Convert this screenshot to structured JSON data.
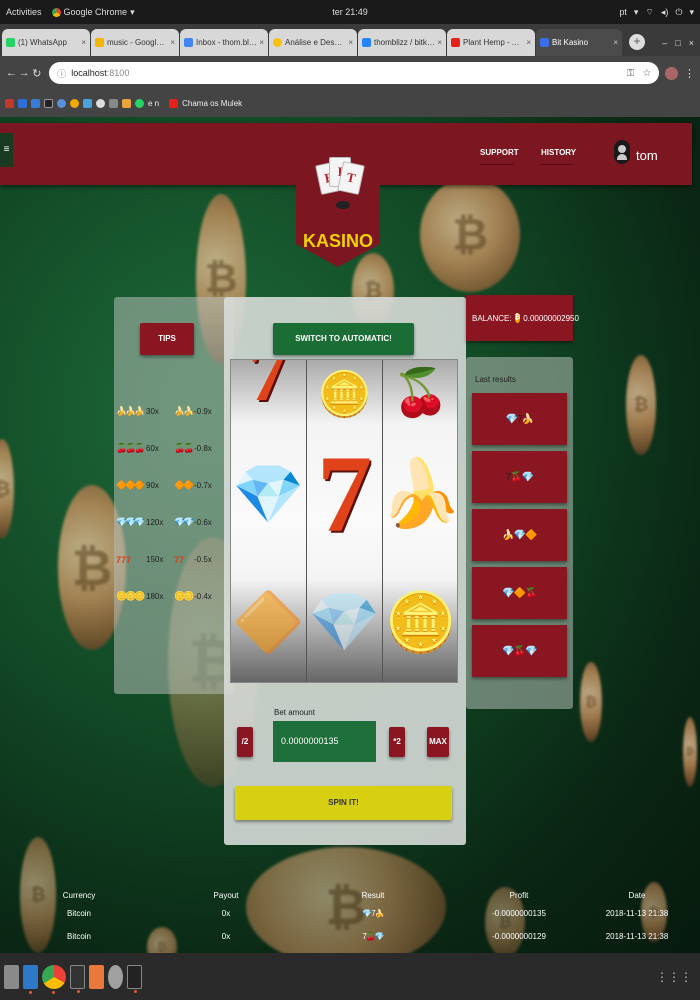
{
  "system": {
    "activities": "Activities",
    "app_name": "Google Chrome",
    "clock": "ter 21:49",
    "lang": "pt"
  },
  "tabs": [
    {
      "title": "(1) WhatsApp",
      "color": "#25d366"
    },
    {
      "title": "music - Google Drive",
      "color": "#f4b400"
    },
    {
      "title": "Inbox - thom.blizz@gmail",
      "color": "#4285f4"
    },
    {
      "title": "Análise e Desenvolvimen",
      "color": "#f4c20d"
    },
    {
      "title": "thomblizz / bitkasino",
      "color": "#2684ff"
    },
    {
      "title": "Plant Hemp - A inva",
      "color": "#e62117"
    },
    {
      "title": "Bit Kasino",
      "color": "#3a6ee8"
    }
  ],
  "address": {
    "host": "localhost",
    "port": ":8100"
  },
  "bookmark_label": "Chama os Mulek",
  "bookmark_en": "e n",
  "header": {
    "support": "SUPPORT",
    "history": "HISTORY",
    "user": "tom"
  },
  "logo": {
    "cards": [
      "B",
      "I",
      "T"
    ],
    "text": "KASINO"
  },
  "tips_label": "TIPS",
  "switch_label": "SWITCH TO AUTOMATIC!",
  "paytable": [
    {
      "symbols": "🍌🍌🍌",
      "mult": "30x",
      "symbols2": "🍌🍌",
      "mult2": "-0.9x"
    },
    {
      "symbols": "🍒🍒🍒",
      "mult": "60x",
      "symbols2": "🍒🍒",
      "mult2": "-0.8x"
    },
    {
      "symbols": "🔶🔶🔶",
      "mult": "90x",
      "symbols2": "🔶🔶",
      "mult2": "-0.7x"
    },
    {
      "symbols": "💎💎💎",
      "mult": "120x",
      "symbols2": "💎💎",
      "mult2": "-0.6x"
    },
    {
      "symbols": "777",
      "mult": "150x",
      "symbols2": "77",
      "mult2": "-0.5x"
    },
    {
      "symbols": "🪙🪙🪙",
      "mult": "180x",
      "symbols2": "🪙🪙",
      "mult2": "-0.4x"
    }
  ],
  "reels": {
    "r1": {
      "top": "7",
      "mid": "💎",
      "bot": "🔶"
    },
    "r2": {
      "top": "🪙",
      "mid": "7",
      "bot": "💎"
    },
    "r3": {
      "top": "🍒",
      "mid": "🍌",
      "bot": "🪙"
    }
  },
  "balance": {
    "label": "BALANCE:",
    "value": "0.00000002950"
  },
  "last_results": {
    "title": "Last results",
    "rows": [
      "💎7🍌",
      "7🍒💎",
      "🍌💎🔶",
      "💎🔶🍒",
      "💎🍒💎"
    ]
  },
  "bet": {
    "label": "Bet amount",
    "value": "0.0000000135",
    "half": "/2",
    "double": "*2",
    "max": "MAX"
  },
  "spin_label": "SPIN IT!",
  "history_table": {
    "headers": {
      "currency": "Currency",
      "payout": "Payout",
      "result": "Result",
      "profit": "Profit",
      "date": "Date"
    },
    "rows": [
      {
        "currency": "Bitcoin",
        "payout": "0x",
        "result": "💎7🍌",
        "profit": "-0.0000000135",
        "date": "2018-11-13 21:38"
      },
      {
        "currency": "Bitcoin",
        "payout": "0x",
        "result": "7🍒💎",
        "profit": "-0.0000000129",
        "date": "2018-11-13 21:38"
      }
    ]
  },
  "colors": {
    "brand_red": "#8a1622",
    "brand_green": "#1a6e35",
    "gold": "#f0d200"
  }
}
